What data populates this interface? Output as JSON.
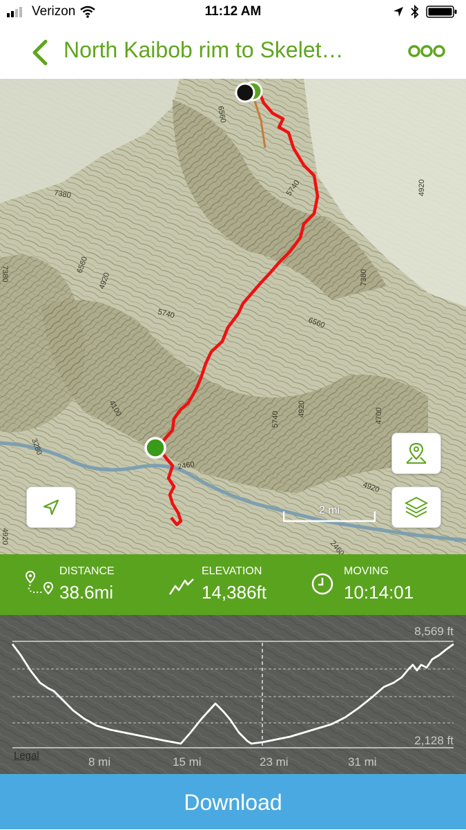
{
  "status_bar": {
    "carrier": "Verizon",
    "time": "11:12 AM"
  },
  "header": {
    "title": "North Kaibob rim to Skelet…"
  },
  "map": {
    "scale_label": "2 mi",
    "contour_labels": [
      "7380",
      "6560",
      "4920",
      "5740",
      "6560",
      "7380",
      "5740",
      "4920",
      "5740",
      "4100",
      "4700",
      "4920",
      "2460",
      "2460",
      "3280",
      "4920",
      "7380",
      "4920",
      "6560"
    ]
  },
  "stats": {
    "distance": {
      "label": "DISTANCE",
      "value": "38.6mi"
    },
    "elevation": {
      "label": "ELEVATION",
      "value": "14,386ft"
    },
    "moving": {
      "label": "MOVING",
      "value": "10:14:01"
    }
  },
  "profile": {
    "max_label": "8,569 ft",
    "min_label": "2,128 ft",
    "x_labels": [
      "8 mi",
      "15 mi",
      "23 mi",
      "31 mi"
    ],
    "legal": "Legal"
  },
  "download_label": "Download",
  "colors": {
    "accent": "#5fa51e",
    "stats_bg": "#5aa31f",
    "route": "#ee1111",
    "download": "#4aa9e0"
  }
}
